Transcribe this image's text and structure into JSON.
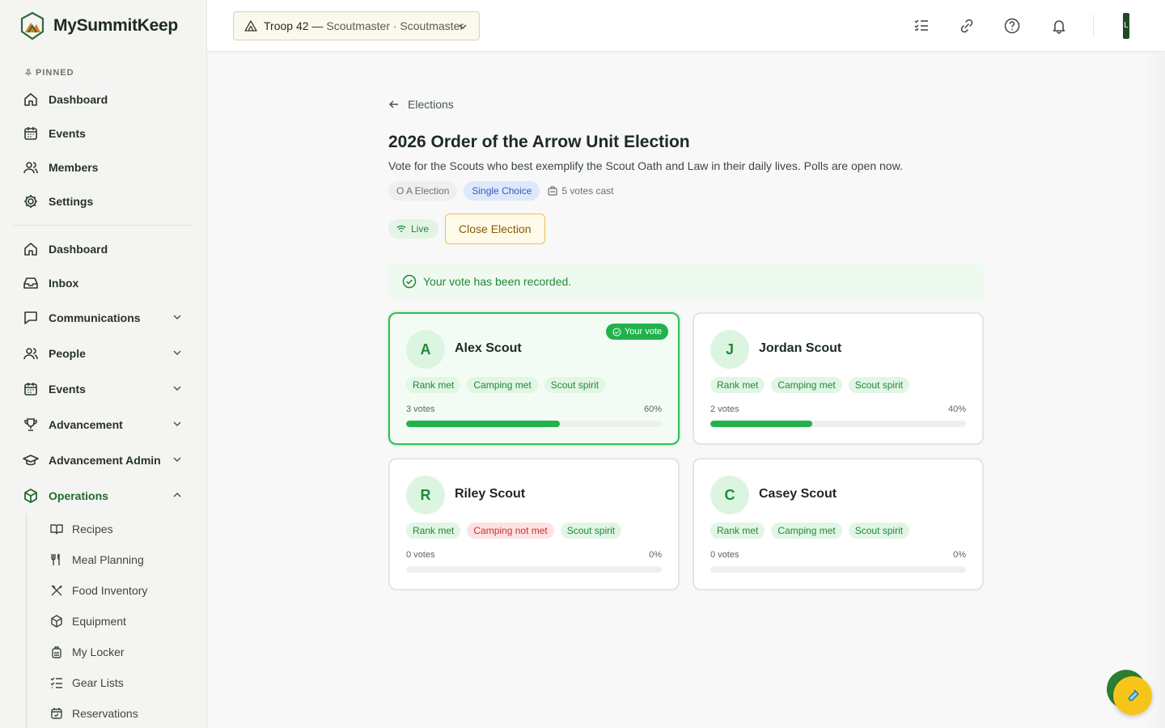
{
  "app": {
    "name": "MySummitKeep"
  },
  "sidebar": {
    "pinned_label": "PINNED",
    "pinned": [
      {
        "label": "Dashboard",
        "icon": "home-icon"
      },
      {
        "label": "Events",
        "icon": "calendar-icon"
      },
      {
        "label": "Members",
        "icon": "users-icon"
      },
      {
        "label": "Settings",
        "icon": "gear-icon"
      }
    ],
    "main": [
      {
        "label": "Dashboard",
        "icon": "home-icon"
      },
      {
        "label": "Inbox",
        "icon": "inbox-icon"
      },
      {
        "label": "Communications",
        "icon": "chat-icon"
      },
      {
        "label": "People",
        "icon": "users-icon"
      },
      {
        "label": "Events",
        "icon": "calendar-icon"
      },
      {
        "label": "Advancement",
        "icon": "trophy-icon"
      },
      {
        "label": "Advancement Admin",
        "icon": "graduation-cap-icon"
      },
      {
        "label": "Operations",
        "icon": "box-icon"
      }
    ],
    "sub": [
      {
        "label": "Recipes",
        "icon": "book-icon"
      },
      {
        "label": "Meal Planning",
        "icon": "utensils-icon"
      },
      {
        "label": "Food Inventory",
        "icon": "crossed-utensils-icon"
      },
      {
        "label": "Equipment",
        "icon": "box-icon"
      },
      {
        "label": "My Locker",
        "icon": "backpack-icon"
      },
      {
        "label": "Gear Lists",
        "icon": "checklist-icon"
      },
      {
        "label": "Reservations",
        "icon": "calendar-check-icon"
      }
    ]
  },
  "topbar": {
    "troop": "Troop 42 —",
    "role": "Scoutmaster · Scoutmaster",
    "avatar_initial": "L"
  },
  "page": {
    "back_label": "Elections",
    "title": "2026 Order of the Arrow Unit Election",
    "description": "Vote for the Scouts who best exemplify the Scout Oath and Law in their daily lives. Polls are open now.",
    "tag_type": "O A Election",
    "tag_mode": "Single Choice",
    "votes_cast": "5 votes cast",
    "status": "Live",
    "close_button": "Close Election",
    "alert": "Your vote has been recorded.",
    "your_vote_label": "Your vote"
  },
  "candidates": [
    {
      "initial": "A",
      "name": "Alex Scout",
      "voted": true,
      "pills": [
        [
          "Rank met",
          true
        ],
        [
          "Camping met",
          true
        ],
        [
          "Scout spirit",
          true
        ]
      ],
      "votes": "3 votes",
      "pct_label": "60%",
      "pct": 60
    },
    {
      "initial": "J",
      "name": "Jordan Scout",
      "voted": false,
      "pills": [
        [
          "Rank met",
          true
        ],
        [
          "Camping met",
          true
        ],
        [
          "Scout spirit",
          true
        ]
      ],
      "votes": "2 votes",
      "pct_label": "40%",
      "pct": 40
    },
    {
      "initial": "R",
      "name": "Riley Scout",
      "voted": false,
      "pills": [
        [
          "Rank met",
          true
        ],
        [
          "Camping not met",
          false
        ],
        [
          "Scout spirit",
          true
        ]
      ],
      "votes": "0 votes",
      "pct_label": "0%",
      "pct": 0
    },
    {
      "initial": "C",
      "name": "Casey Scout",
      "voted": false,
      "pills": [
        [
          "Rank met",
          true
        ],
        [
          "Camping met",
          true
        ],
        [
          "Scout spirit",
          true
        ]
      ],
      "votes": "0 votes",
      "pct_label": "0%",
      "pct": 0
    }
  ],
  "colors": {
    "accent": "#22b24c",
    "brand": "#1d4a25",
    "warning": "#e8c24a"
  }
}
